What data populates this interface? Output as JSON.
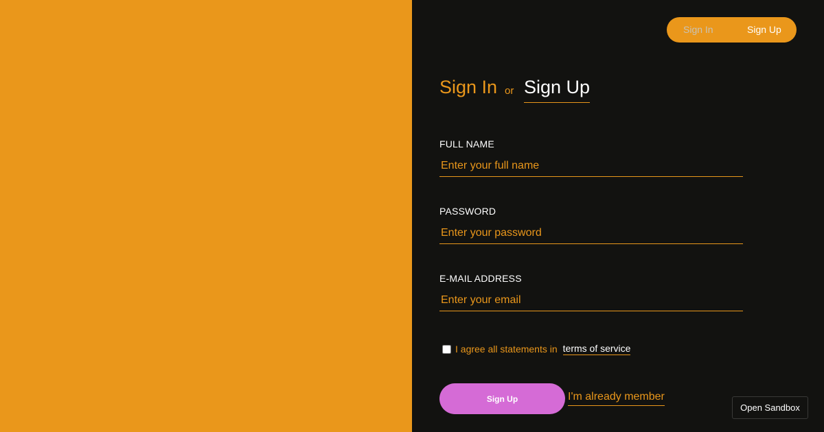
{
  "toggle": {
    "sign_in": "Sign In",
    "sign_up": "Sign Up"
  },
  "heading": {
    "sign_in": "Sign In",
    "or": "or",
    "sign_up": "Sign Up"
  },
  "form": {
    "full_name": {
      "label": "FULL NAME",
      "placeholder": "Enter your full name",
      "value": ""
    },
    "password": {
      "label": "PASSWORD",
      "placeholder": "Enter your password",
      "value": ""
    },
    "email": {
      "label": "E-MAIL ADDRESS",
      "placeholder": "Enter your email",
      "value": ""
    },
    "terms": {
      "text": "I agree all statements in",
      "link": "terms of service",
      "checked": false
    },
    "submit_label": "Sign Up",
    "member_link": "I'm already member"
  },
  "sandbox_label": "Open Sandbox",
  "colors": {
    "accent": "#ea971b",
    "panel": "#121210",
    "button": "#d56bd6",
    "text": "#ffffff"
  }
}
